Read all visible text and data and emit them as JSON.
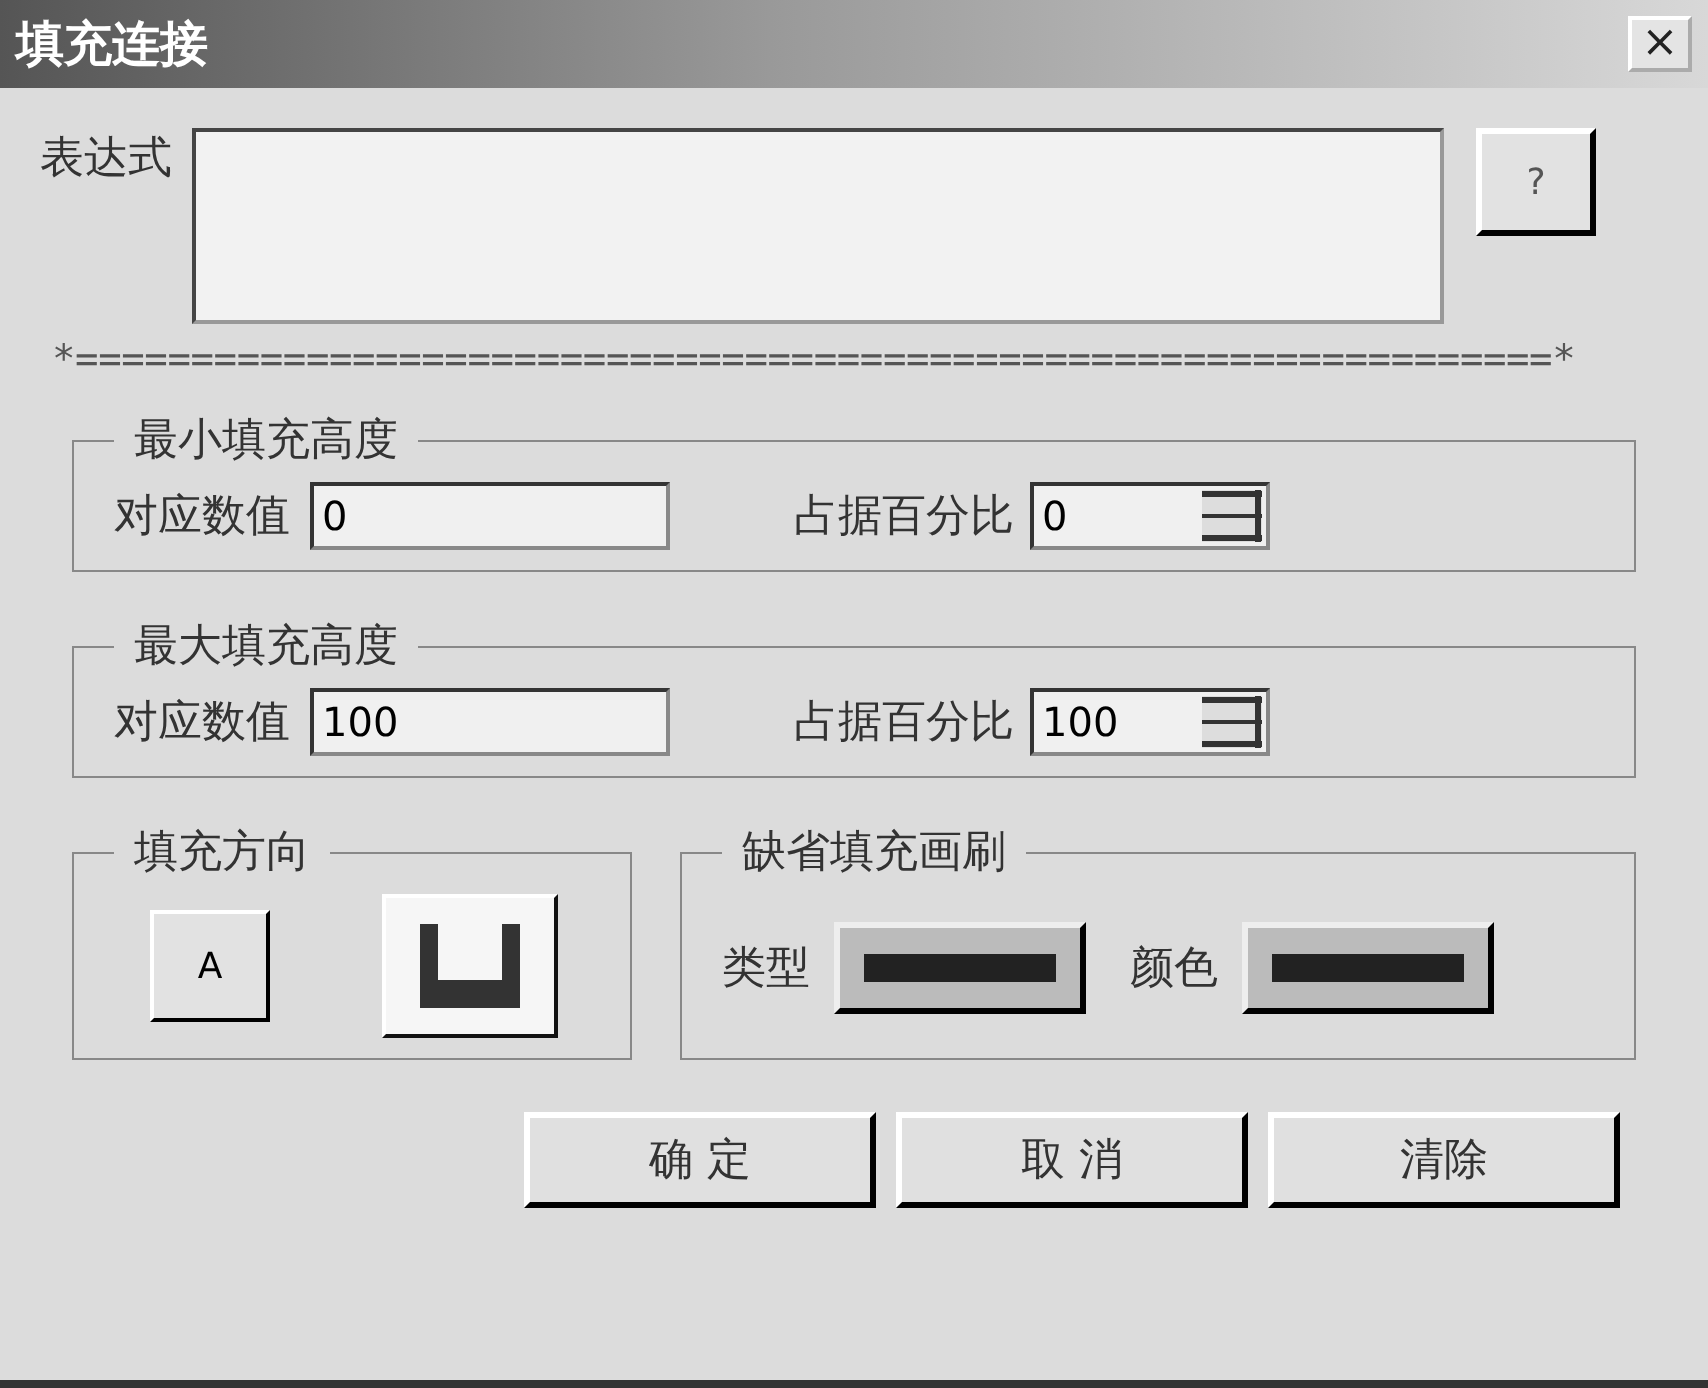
{
  "window": {
    "title": "填充连接",
    "close": "×"
  },
  "expression": {
    "label": "表达式",
    "help_button": "?"
  },
  "separator": "*================================================================*",
  "groups": [
    {
      "title": "最小填充高度",
      "value_label": "对应数值",
      "value": "0",
      "percent_label": "占据百分比",
      "percent": "0"
    },
    {
      "title": "最大填充高度",
      "value_label": "对应数值",
      "value": "100",
      "percent_label": "占据百分比",
      "percent": "100"
    }
  ],
  "direction": {
    "title": "填充方向",
    "text_button": "A"
  },
  "brush": {
    "title": "缺省填充画刷",
    "type_label": "类型",
    "color_label": "颜色"
  },
  "buttons": [
    "确 定",
    "取 消",
    "清除"
  ]
}
